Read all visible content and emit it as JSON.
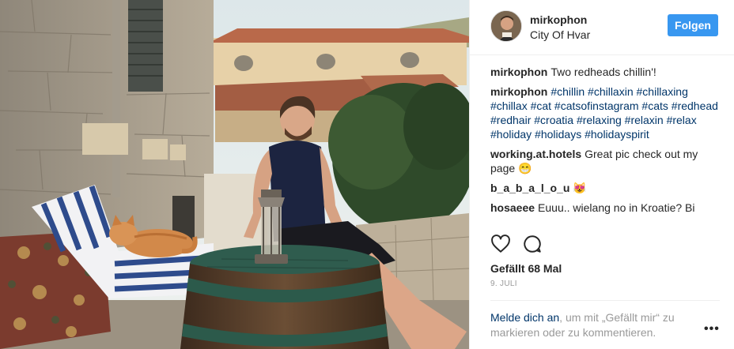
{
  "post": {
    "username": "mirkophon",
    "location": "City Of Hvar",
    "follow_label": "Folgen",
    "caption": {
      "user": "mirkophon",
      "text": "Two redheads chillin'!"
    },
    "hashtag_comment": {
      "user": "mirkophon",
      "text": "#chillin #chillaxin #chillaxing #chillax #cat #catsofinstagram #cats #redhead #redhair #croatia #relaxing #relaxin #relax #holiday #holidays #holidayspirit"
    },
    "comments": [
      {
        "user": "working.at.hotels",
        "text": "Great pic check out my page 😁"
      },
      {
        "user": "b_a_b_a_l_o_u",
        "text": "😻"
      },
      {
        "user": "hosaeee",
        "text": "Euuu.. wielang no in Kroatie? Bi"
      }
    ],
    "likes": "Gefällt 68 Mal",
    "date": "9. JULI",
    "login_prompt": {
      "link": "Melde dich an",
      "text": ", um mit „Gefällt mir“ zu markieren oder zu kommentieren."
    },
    "more_label": "•••"
  },
  "icons": {
    "like": "heart-icon",
    "comment": "comment-icon",
    "more": "more-options-icon"
  },
  "colors": {
    "follow_button": "#3897f0",
    "link": "#003569",
    "muted": "#999999"
  }
}
